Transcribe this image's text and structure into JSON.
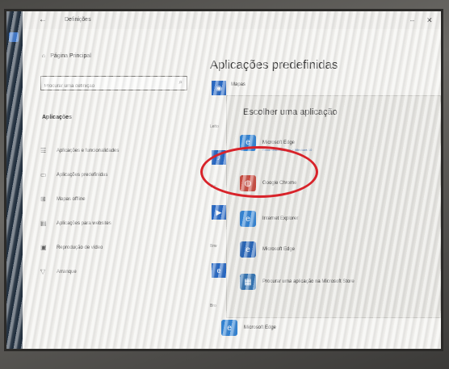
{
  "window": {
    "title": "Definições",
    "back_glyph": "←",
    "minimize_glyph": "–",
    "close_glyph": "✕"
  },
  "sidebar": {
    "home_label": "Página Principal",
    "search_placeholder": "Procurar uma definição",
    "section_title": "Aplicações",
    "items": [
      {
        "icon": "apps-list-icon",
        "label": "Aplicações e funcionalidades"
      },
      {
        "icon": "default-apps-icon",
        "label": "Aplicações predefinidas"
      },
      {
        "icon": "offline-maps-icon",
        "label": "Mapas offline"
      },
      {
        "icon": "websites-apps-icon",
        "label": "Aplicações para websites"
      },
      {
        "icon": "video-playback-icon",
        "label": "Reprodução de vídeo"
      },
      {
        "icon": "startup-icon",
        "label": "Arranque"
      }
    ]
  },
  "content": {
    "page_title": "Aplicações predefinidas",
    "mail_label": "Mapas",
    "side_labels": [
      "Leito",
      "Mús",
      "Vis",
      "Brw",
      "Bro"
    ]
  },
  "flyout": {
    "title": "Escolher uma aplicação",
    "apps": [
      {
        "name": "Microsoft Edge",
        "sub": "Recomendado para o Windows 10",
        "icon": "edge-icon",
        "color": "#2a7fd4"
      },
      {
        "name": "Google Chrome",
        "sub": "",
        "icon": "chrome-icon",
        "color": "#c8463a"
      },
      {
        "name": "Internet Explorer",
        "sub": "",
        "icon": "internet-explorer-icon",
        "color": "#2a7fd4"
      },
      {
        "name": "Microsoft Edge",
        "sub": "",
        "icon": "edge-legacy-icon",
        "color": "#1f5fb5"
      },
      {
        "name": "Procurar uma aplicação na Microsoft Store",
        "sub": "",
        "icon": "store-icon",
        "color": "#2d6fb0"
      }
    ],
    "bottom_app": "Microsoft Edge"
  },
  "colors": {
    "highlight": "#d8232a",
    "accent": "#1f63c3"
  }
}
